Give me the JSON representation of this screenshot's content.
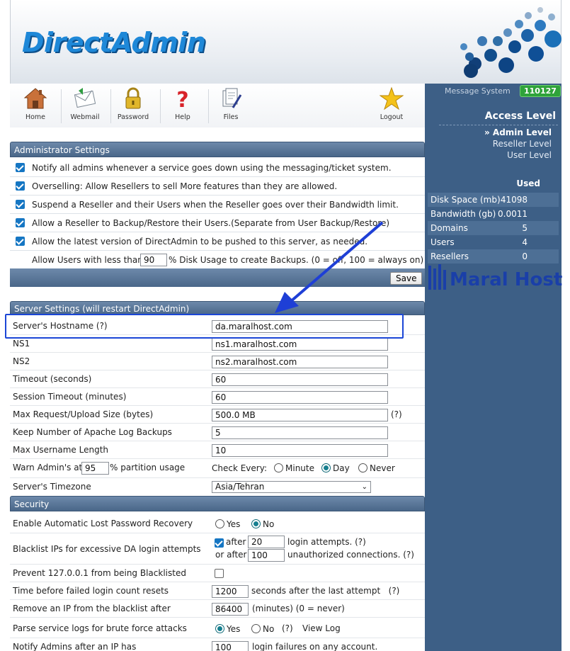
{
  "header": {
    "logo": "DirectAdmin"
  },
  "toolbar": {
    "items": [
      {
        "label": "Home",
        "icon": "home-icon"
      },
      {
        "label": "Webmail",
        "icon": "webmail-icon"
      },
      {
        "label": "Password",
        "icon": "lock-icon"
      },
      {
        "label": "Help",
        "icon": "help-icon"
      },
      {
        "label": "Files",
        "icon": "files-icon"
      },
      {
        "label": "Logout",
        "icon": "star-icon"
      }
    ]
  },
  "sidebar": {
    "message_system": "Message System",
    "message_count": "110127",
    "access_title": "Access Level",
    "levels": [
      "» Admin Level",
      "Reseller Level",
      "User Level"
    ],
    "used_head": "Used",
    "stats": [
      {
        "label": "Disk Space (mb)",
        "value": "41098"
      },
      {
        "label": "Bandwidth (gb)",
        "value": "0.0011"
      },
      {
        "label": "Domains",
        "value": "5"
      },
      {
        "label": "Users",
        "value": "4"
      },
      {
        "label": "Resellers",
        "value": "0"
      }
    ],
    "brand": "Maral Host"
  },
  "admin": {
    "title": "Administrator Settings",
    "options": [
      "Notify all admins whenever a service goes down using the messaging/ticket system.",
      "Overselling: Allow Resellers to sell More features than they are allowed.",
      "Suspend a Reseller and their Users when the Reseller goes over their Bandwidth limit.",
      "Allow a Reseller to Backup/Restore their Users.(Separate from User Backup/Restore)",
      "Allow the latest version of DirectAdmin to be pushed to this server, as needed."
    ],
    "backup_prefix": "Allow Users with less than",
    "backup_value": "90",
    "backup_suffix": "% Disk Usage to create Backups. (0 = off, 100 = always on)",
    "save": "Save"
  },
  "server": {
    "title": "Server Settings (will restart DirectAdmin)",
    "hostname_label": "Server's Hostname (?)",
    "hostname": "da.maralhost.com",
    "ns1_label": "NS1",
    "ns1": "ns1.maralhost.com",
    "ns2_label": "NS2",
    "ns2": "ns2.maralhost.com",
    "timeout_label": "Timeout (seconds)",
    "timeout": "60",
    "session_label": "Session Timeout (minutes)",
    "session": "60",
    "upload_label": "Max Request/Upload Size (bytes)",
    "upload": "500.0 MB",
    "upload_help": "(?)",
    "apache_label": "Keep Number of Apache Log Backups",
    "apache": "5",
    "username_label": "Max Username Length",
    "username": "10",
    "warn_prefix": "Warn Admin's at",
    "warn_value": "95",
    "warn_suffix": "% partition usage",
    "check_every": "Check Every:",
    "freq": [
      "Minute",
      "Day",
      "Never"
    ],
    "freq_selected": "Day",
    "tz_label": "Server's Timezone",
    "tz": "Asia/Tehran"
  },
  "security": {
    "title": "Security",
    "lostpw_label": "Enable Automatic Lost Password Recovery",
    "yes": "Yes",
    "no": "No",
    "blacklist_label": "Blacklist IPs for excessive DA login attempts",
    "after": "after",
    "or_after": "or after",
    "login_attempts_value": "20",
    "login_attempts_text": "login attempts. (?)",
    "unauth_value": "100",
    "unauth_text": "unauthorized connections. (?)",
    "prevent_label": "Prevent 127.0.0.1 from being Blacklisted",
    "reset_label": "Time before failed login count resets",
    "reset_value": "1200",
    "reset_text": "seconds after the last attempt   (?)",
    "remove_label": "Remove an IP from the blacklist after",
    "remove_value": "86400",
    "remove_text": "(minutes) (0 = never)",
    "parse_label": "Parse service logs for brute force attacks",
    "help": "(?)",
    "view_log": "View Log",
    "notify_label": "Notify Admins after an IP has",
    "notify_value": "100",
    "notify_text": "login failures on any account."
  },
  "colors": {
    "sidebar": "#3d5f86",
    "section": "#4a6789",
    "accent": "#1e88d8",
    "highlight": "#1b46d6"
  }
}
